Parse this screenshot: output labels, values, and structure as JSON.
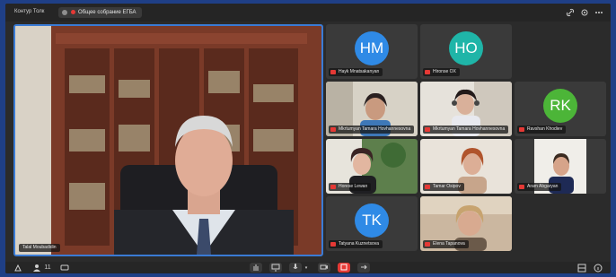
{
  "topbar": {
    "app_title": "Контур Толк",
    "meeting_name": "Общее собрание ЕГБА",
    "icons": [
      "link-icon",
      "settings-icon",
      "more-icon"
    ]
  },
  "main_speaker": {
    "name": "Talal Moubadidin"
  },
  "participants": [
    {
      "initials": "HM",
      "name": "Hayk Mnatsakanyan",
      "avatar_color": "#2f8ae6",
      "muted": true
    },
    {
      "initials": "HO",
      "name": "Hironse OX",
      "avatar_color": "#1fb5a8",
      "muted": true
    },
    {
      "initials": "",
      "name": "Mkrtumyan Tamara Hovhannesovna",
      "muted": true
    },
    {
      "initials": "",
      "name": "Mkrtumyan Tamara Hovhannesovna",
      "muted": true
    },
    {
      "initials": "RK",
      "name": "Ravshan Khodiev",
      "avatar_color": "#4cb538",
      "muted": true
    },
    {
      "initials": "",
      "name": "Horese Lewan",
      "muted": true
    },
    {
      "initials": "",
      "name": "Tamar Osipov",
      "muted": true
    },
    {
      "initials": "",
      "name": "Aram Abgaryan",
      "muted": true
    },
    {
      "initials": "TK",
      "name": "Tatyana Kuznetsova",
      "avatar_color": "#2f8ae6",
      "muted": true
    },
    {
      "initials": "",
      "name": "Elena Tapanova",
      "muted": true
    }
  ],
  "bottombar": {
    "participants_count": "11",
    "icons": [
      "share-icon",
      "participants-icon",
      "chat-icon",
      "raise-hand-icon",
      "screen-share-icon",
      "microphone-icon",
      "camera-off-icon",
      "end-call-icon",
      "leave-icon",
      "info-icon"
    ]
  }
}
